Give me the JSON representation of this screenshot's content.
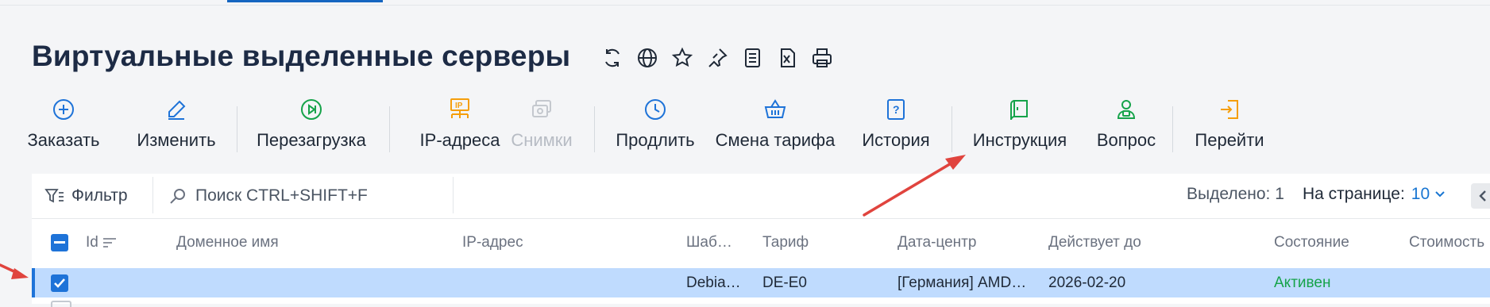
{
  "page": {
    "title": "Виртуальные выделенные серверы"
  },
  "title_icons": [
    "refresh-icon",
    "globe-icon",
    "star-icon",
    "pin-icon",
    "list-doc-icon",
    "excel-icon",
    "print-icon"
  ],
  "toolbar": {
    "items": [
      {
        "label": "Заказать",
        "icon": "plus-circle-icon",
        "color": "#1e73d8",
        "disabled": false
      },
      {
        "label": "Изменить",
        "icon": "pencil-icon",
        "color": "#1e73d8",
        "disabled": false
      },
      {
        "label": "Перезагрузка",
        "icon": "reboot-icon",
        "color": "#16a34a",
        "disabled": false
      },
      {
        "label": "IP-адреса",
        "icon": "ip-icon",
        "color": "#f59e0b",
        "disabled": false
      },
      {
        "label": "Снимки",
        "icon": "snapshot-icon",
        "color": "#c4c8ce",
        "disabled": true
      },
      {
        "label": "Продлить",
        "icon": "clock-icon",
        "color": "#1e73d8",
        "disabled": false
      },
      {
        "label": "Смена тарифа",
        "icon": "basket-icon",
        "color": "#1e73d8",
        "disabled": false
      },
      {
        "label": "История",
        "icon": "history-icon",
        "color": "#1e73d8",
        "disabled": false
      },
      {
        "label": "Инструкция",
        "icon": "manual-icon",
        "color": "#16a34a",
        "disabled": false
      },
      {
        "label": "Вопрос",
        "icon": "support-icon",
        "color": "#16a34a",
        "disabled": false
      },
      {
        "label": "Перейти",
        "icon": "goto-icon",
        "color": "#f59e0b",
        "disabled": false
      }
    ]
  },
  "filterbar": {
    "filter_label": "Фильтр",
    "search_placeholder": "Поиск CTRL+SHIFT+F",
    "selected_label": "Выделено: 1",
    "per_page_label": "На странице:",
    "per_page_value": "10"
  },
  "table": {
    "columns": [
      "Id",
      "Доменное имя",
      "IP-адрес",
      "Шаб…",
      "Тариф",
      "Дата-центр",
      "Действует до",
      "Состояние",
      "Стоимость"
    ],
    "rows": [
      {
        "id": "",
        "domain": "",
        "ip": "",
        "template": "Debia…",
        "tariff": "DE-E0",
        "datacenter": "[Германия] AMD…",
        "valid_until": "2026-02-20",
        "status": "Активен",
        "cost": "",
        "selected": true
      }
    ]
  },
  "colors": {
    "accent": "#1e73d8",
    "status_active": "#16a34a",
    "selected_row": "#bfdbfe",
    "annotation_arrow": "#e0443e"
  }
}
